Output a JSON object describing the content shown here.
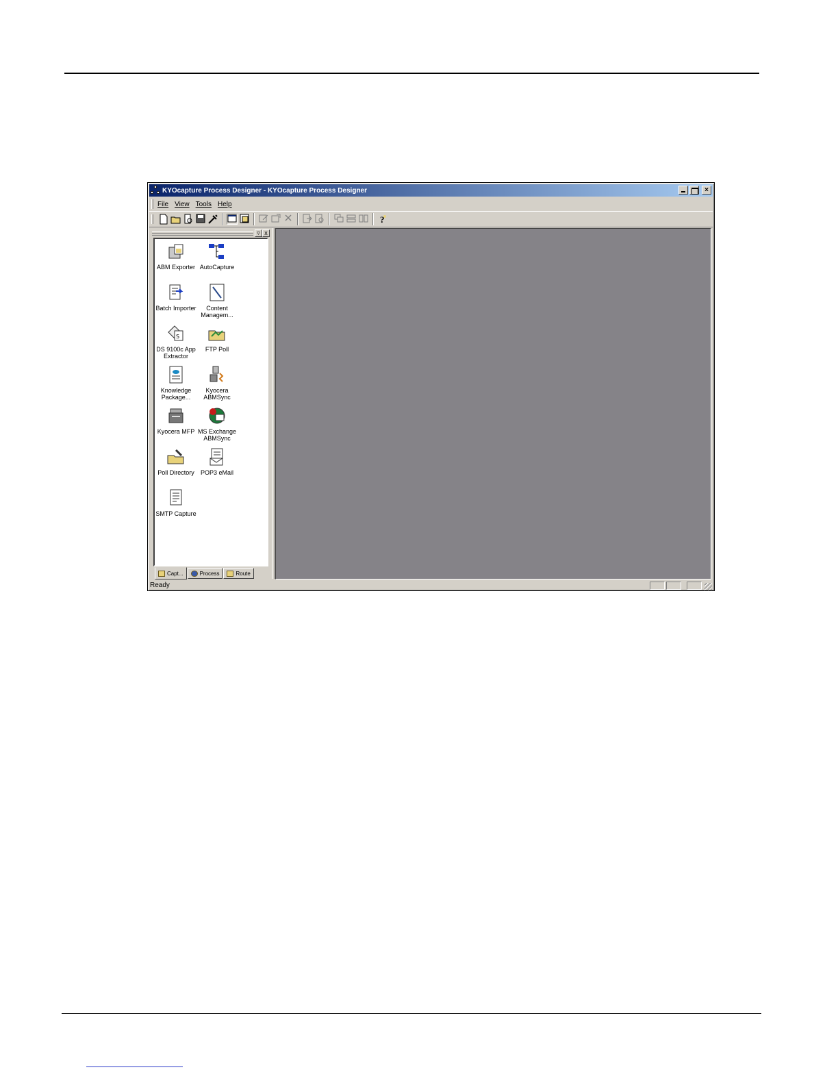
{
  "window": {
    "title": "KYOcapture Process Designer - KYOcapture Process Designer",
    "close_glyph": "×"
  },
  "menu": [
    "File",
    "View",
    "Tools",
    "Help"
  ],
  "toolbar": {
    "icons": [
      "new-file-icon",
      "open-folder-icon",
      "print-preview-icon",
      "save-icon",
      "tools-icon",
      "view-toggle-icon",
      "window-icon",
      "edit-icon",
      "properties-icon",
      "delete-icon",
      "import-icon",
      "export-icon",
      "cascade-icon",
      "tile-horizontal-icon",
      "tile-vertical-icon",
      "help-icon"
    ]
  },
  "panel": {
    "pin_glyph": "▿",
    "close_glyph": "x",
    "items": [
      {
        "label": "ABM Exporter",
        "icon": "abm-exporter-icon"
      },
      {
        "label": "AutoCapture",
        "icon": "autocapture-icon"
      },
      {
        "label": "Batch Importer",
        "icon": "batch-importer-icon"
      },
      {
        "label": "Content Managem...",
        "icon": "content-management-icon"
      },
      {
        "label": "DS 9100c App Extractor",
        "icon": "ds-app-extractor-icon"
      },
      {
        "label": "FTP Poll",
        "icon": "ftp-poll-icon"
      },
      {
        "label": "Knowledge Package...",
        "icon": "knowledge-package-icon"
      },
      {
        "label": "Kyocera ABMSync",
        "icon": "kyocera-abmsync-icon"
      },
      {
        "label": "Kyocera MFP",
        "icon": "kyocera-mfp-icon"
      },
      {
        "label": "MS Exchange ABMSync",
        "icon": "ms-exchange-icon"
      },
      {
        "label": "Poll Directory",
        "icon": "poll-directory-icon"
      },
      {
        "label": "POP3 eMail",
        "icon": "pop3-email-icon"
      },
      {
        "label": "SMTP Capture",
        "icon": "smtp-capture-icon"
      }
    ],
    "tabs": [
      "Capt...",
      "Process",
      "Route"
    ]
  },
  "status": {
    "text": "Ready"
  },
  "colors": {
    "title_start": "#0a246a",
    "title_end": "#a6caf0",
    "workspace": "#858388",
    "chrome": "#d4d0c8",
    "footer_link": "#2a39c9"
  }
}
